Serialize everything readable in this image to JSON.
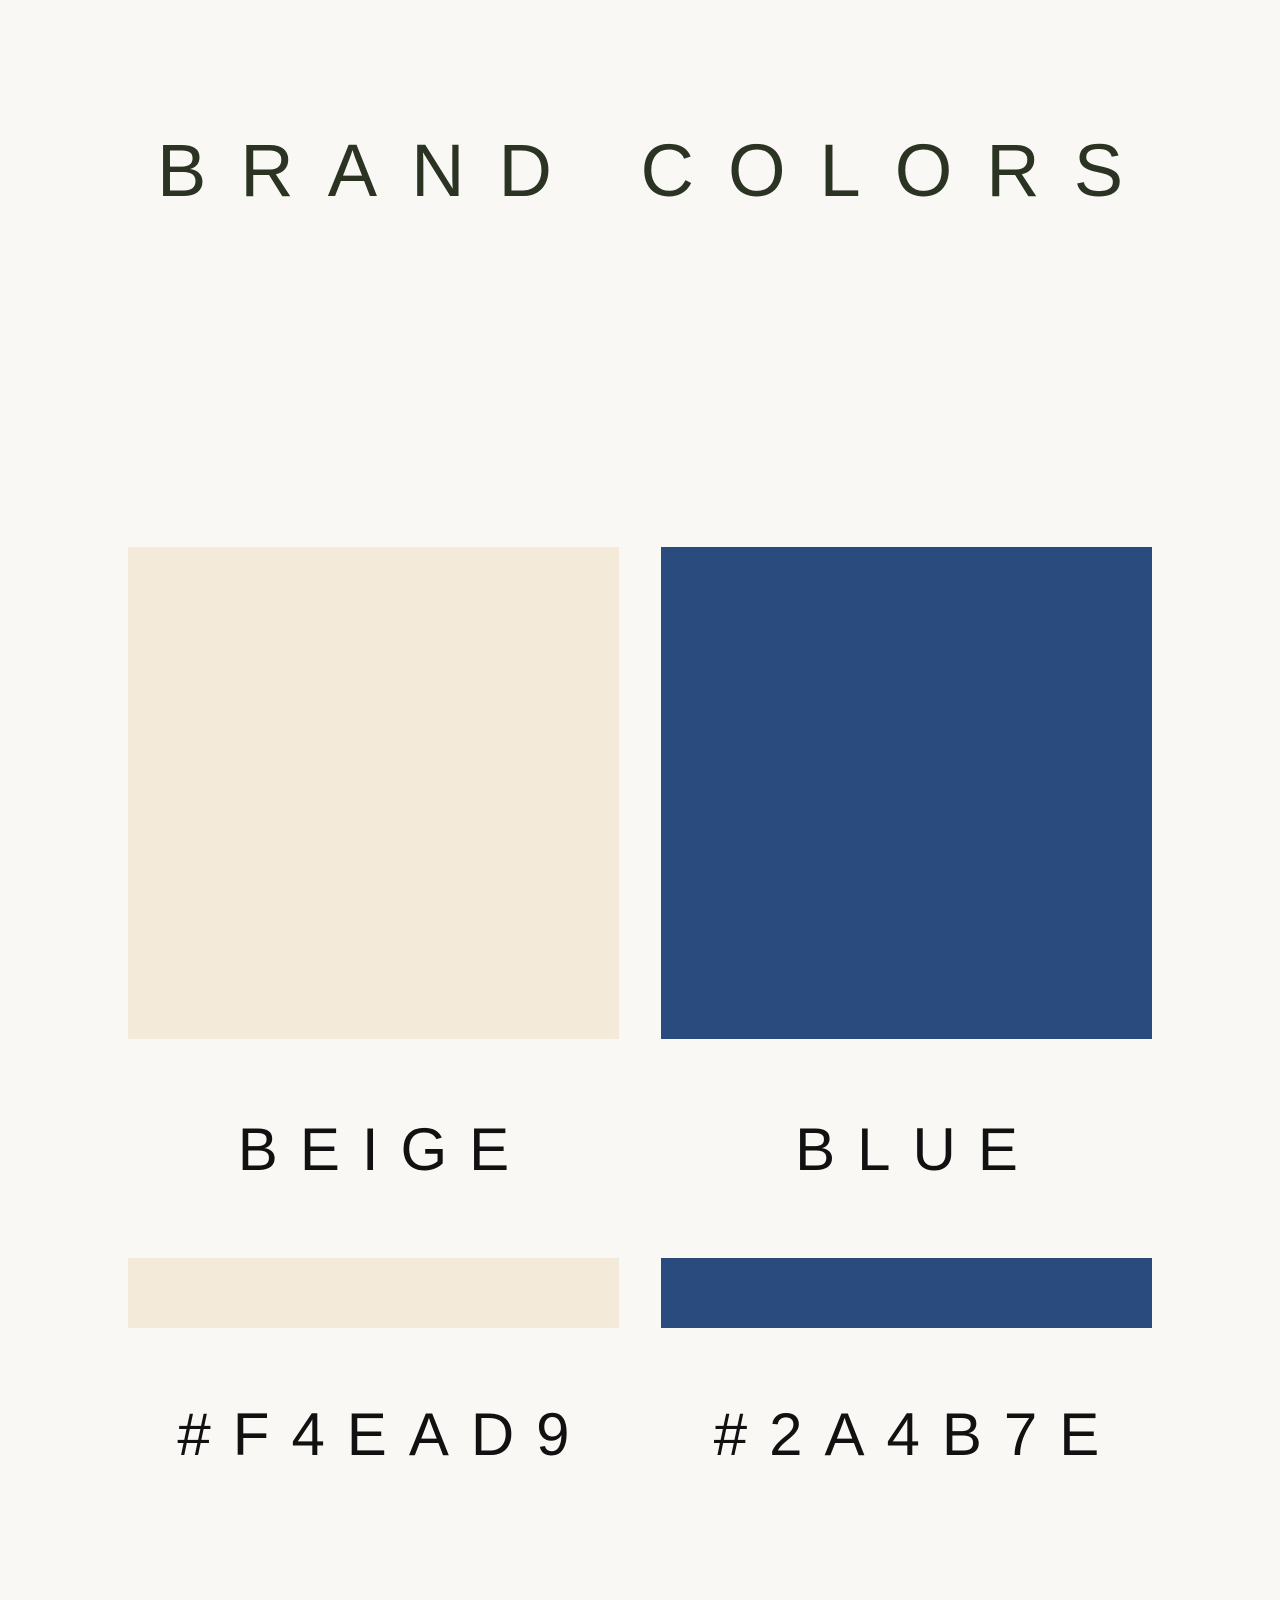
{
  "title": "BRAND COLORS",
  "swatches": [
    {
      "name": "BEIGE",
      "hex_label": "#F4EAD9",
      "color": "#F4EAD9"
    },
    {
      "name": "BLUE",
      "hex_label": "#2A4B7E",
      "color": "#2A4B7E"
    }
  ],
  "background_color": "#F9F8F5",
  "title_color": "#2B3323"
}
